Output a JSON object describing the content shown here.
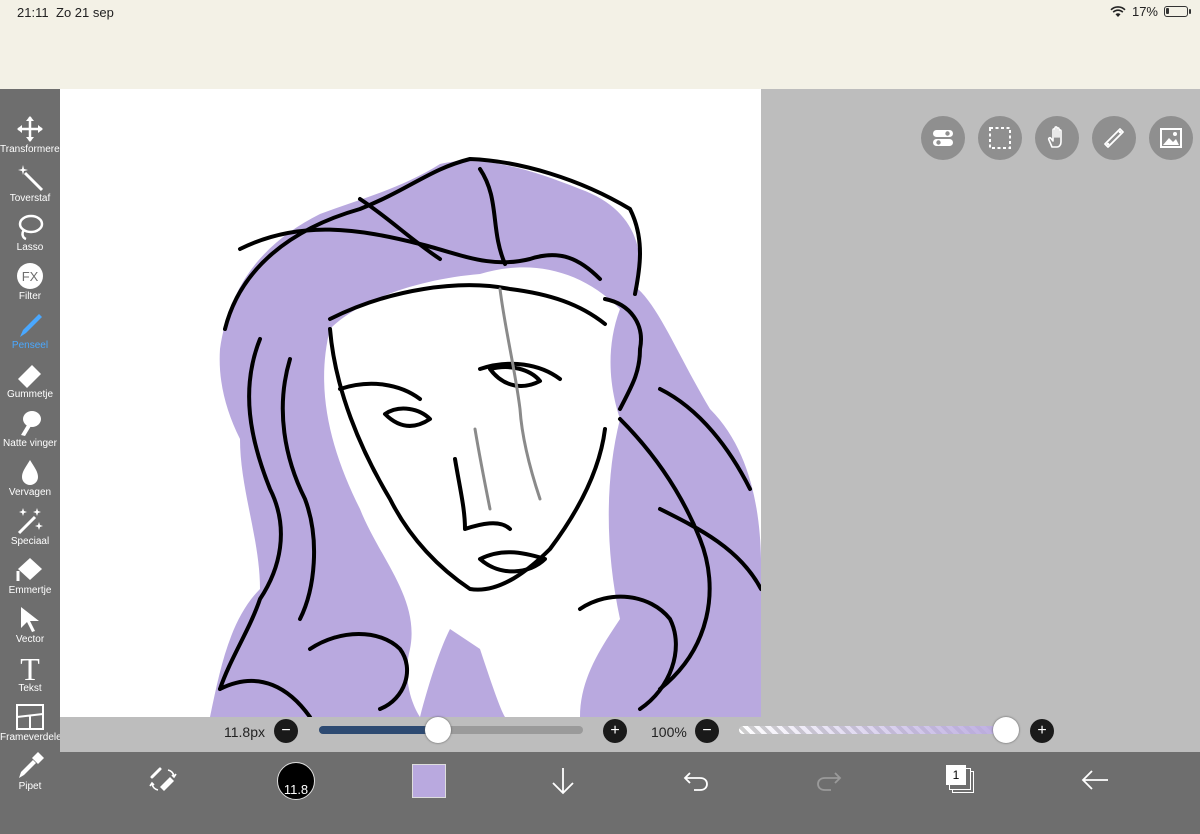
{
  "status": {
    "time": "21:11",
    "date": "Zo 21 sep",
    "battery_pct": "17%",
    "battery_level": 0.17
  },
  "sidebar": {
    "tools": [
      {
        "label": "Transformeren",
        "icon": "move-icon"
      },
      {
        "label": "Toverstaf",
        "icon": "magic-wand-icon"
      },
      {
        "label": "Lasso",
        "icon": "lasso-icon"
      },
      {
        "label": "Filter",
        "icon": "fx-icon",
        "glyph": "FX"
      },
      {
        "label": "Penseel",
        "icon": "brush-icon",
        "active": true
      },
      {
        "label": "Gummetje",
        "icon": "eraser-icon"
      },
      {
        "label": "Natte vinger",
        "icon": "smudge-icon"
      },
      {
        "label": "Vervagen",
        "icon": "blur-drop-icon"
      },
      {
        "label": "Speciaal",
        "icon": "sparkle-icon"
      },
      {
        "label": "Emmertje",
        "icon": "bucket-icon"
      },
      {
        "label": "Vector",
        "icon": "cursor-arrow-icon"
      },
      {
        "label": "Tekst",
        "icon": "text-icon",
        "glyph": "T"
      },
      {
        "label": "Frameverdeler",
        "icon": "frame-divider-icon"
      },
      {
        "label": "Pipet",
        "icon": "eyedropper-icon"
      }
    ]
  },
  "topright_buttons": [
    "toggle-icon",
    "selection-icon",
    "hand-icon",
    "ruler-icon",
    "image-icon"
  ],
  "sliders": {
    "size_label": "11.8px",
    "size_level": 0.45,
    "opacity_label": "100%",
    "opacity_level": 1.0
  },
  "bottom": {
    "brush_size_label": "11.8",
    "color": "#b9a9df",
    "layers_count": "1"
  },
  "colors": {
    "accent": "#4aa8ff",
    "hair": "#b9a9df",
    "panel": "#6e6e6e"
  }
}
